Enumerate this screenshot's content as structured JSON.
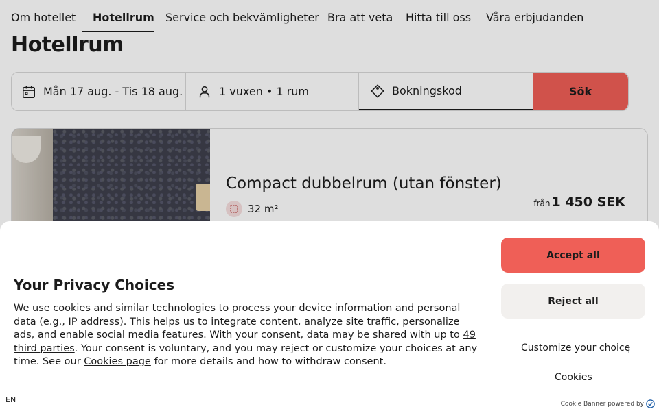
{
  "nav": {
    "items": [
      {
        "label": "Om hotellet",
        "active": false
      },
      {
        "label": "Hotellrum",
        "active": true
      },
      {
        "label": "Service och bekvämligheter",
        "active": false
      },
      {
        "label": "Bra att veta",
        "active": false
      },
      {
        "label": "Hitta till oss",
        "active": false
      },
      {
        "label": "Våra erbjudanden",
        "active": false
      }
    ]
  },
  "page_title": "Hotellrum",
  "search": {
    "dates": "Mån 17 aug. - Tis 18 aug.",
    "guests": "1 vuxen • 1 rum",
    "code_placeholder": "Bokningskod",
    "button_label": "Sök",
    "accent": "#ef5f57"
  },
  "room": {
    "title": "Compact dubbelrum (utan fönster)",
    "size": "32 m²",
    "price_from": "från",
    "price": "1 450 SEK"
  },
  "cookie_banner": {
    "title": "Your Privacy Choices",
    "text_1": "We use cookies and similar technologies to process your device information and personal data (e.g., IP address). This helps us to integrate content, analyze site traffic, personalize ads, and enable social media features. With your consent, data may be shared with up to ",
    "third_parties_link": "49 third parties",
    "text_2": ". Your consent is voluntary, and you may reject or customize your choices at any time. See our ",
    "cookies_page_link": "Cookies page",
    "text_3": " for more details and how to withdraw consent.",
    "accept_label": "Accept all",
    "reject_label": "Reject all",
    "customize_label": "Customize your choice",
    "separator": "|",
    "cookies_label": "Cookies",
    "language": "EN",
    "powered_by": "Cookie Banner powered by",
    "accept_color": "#ef5f57"
  }
}
